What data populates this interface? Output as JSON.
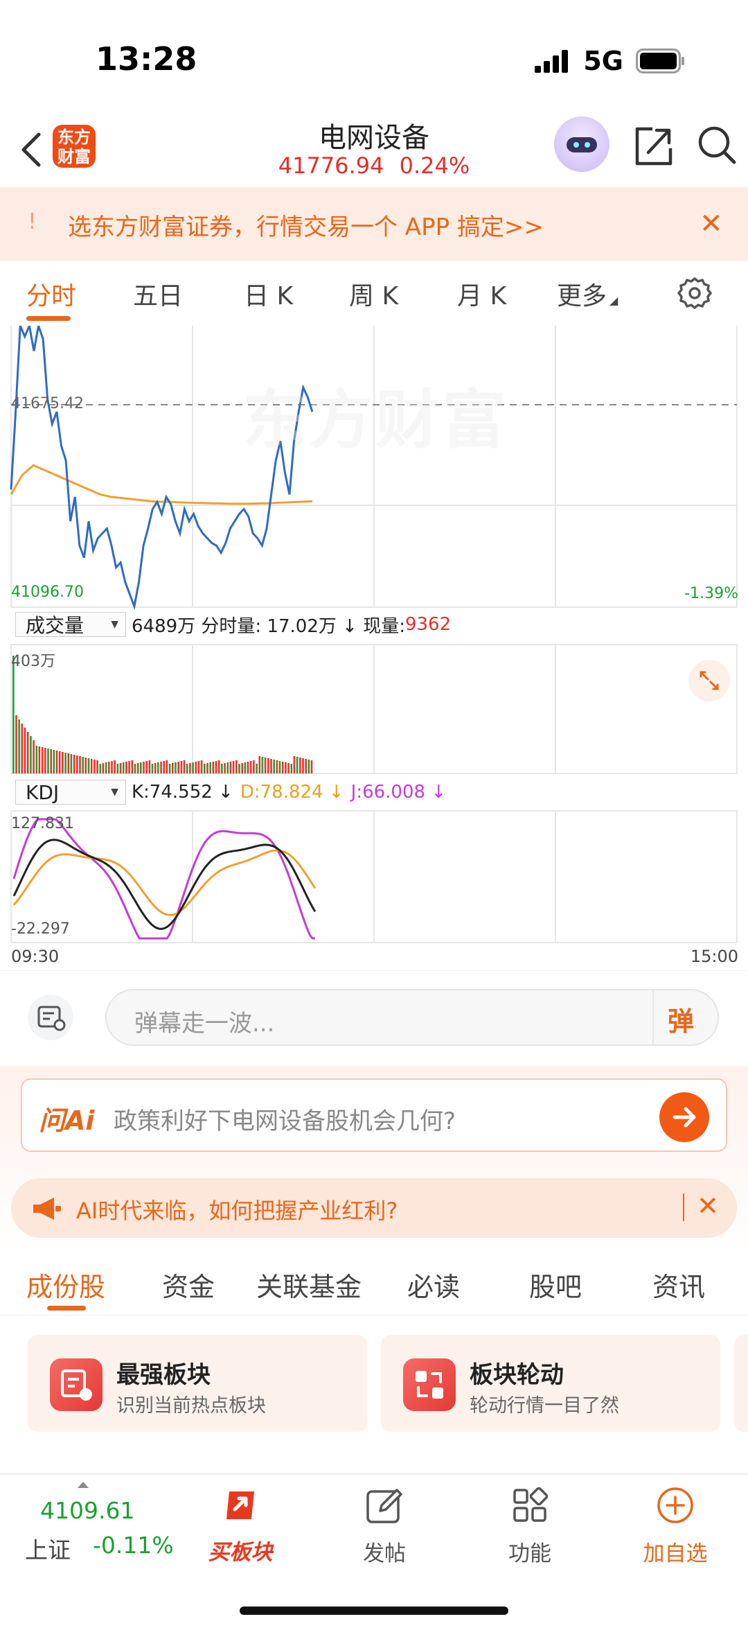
{
  "status_bar": {
    "time": "13:28",
    "network": "5G"
  },
  "header": {
    "logo_text": "东方财富",
    "title": "电网设备",
    "price": "41776.94",
    "change_pct": "0.24%"
  },
  "promo": {
    "mark": "!",
    "text": "选东方财富证券，行情交易一个 APP 搞定>>",
    "close": "✕"
  },
  "chart_tabs": [
    {
      "label": "分时",
      "active": true
    },
    {
      "label": "五日",
      "active": false
    },
    {
      "label": "日 K",
      "active": false
    },
    {
      "label": "周 K",
      "active": false
    },
    {
      "label": "月 K",
      "active": false
    },
    {
      "label": "更多",
      "active": false
    }
  ],
  "chart": {
    "watermark": "东方财富",
    "avg_price_label": "41675.42",
    "low_label": "41096.70",
    "low_pct_label": "-1.39%",
    "volume": {
      "selector": "成交量",
      "summary": "6489万 分时量: 17.02万 ↓ 现量: ",
      "current": "9362",
      "max_label": "403万"
    },
    "kdj": {
      "selector": "KDJ",
      "k": "K:74.552 ↓",
      "d": "D:78.824 ↓",
      "j": "J:66.008 ↓",
      "max_label": "127.831",
      "min_label": "-22.297"
    },
    "time_start": "09:30",
    "time_end": "15:00",
    "colors": {
      "price_line": "#2e6cc0",
      "avg_line": "#f0a030",
      "up": "#e8322a",
      "down": "#1aa032",
      "k": "#222222",
      "d": "#f0a030",
      "j": "#c33cd8"
    }
  },
  "chart_data": {
    "type": "line",
    "title": "",
    "xlabel": "",
    "ylabel": "",
    "x_range": [
      "09:30",
      "15:00"
    ],
    "ylim": [
      41096.7,
      42254.14
    ],
    "reference": 41675.42,
    "series": [
      {
        "values": [
          41580,
          41900,
          42254,
          42210,
          42254,
          42150,
          42254,
          42200,
          41950,
          41850,
          41900,
          41760,
          41700,
          41450,
          41550,
          41350,
          41300,
          41450,
          41330,
          41380,
          41400,
          41420,
          41350,
          41260,
          41280,
          41200,
          41150,
          41100,
          41200,
          41350,
          41420,
          41500,
          41530,
          41480,
          41550,
          41520,
          41450,
          41400,
          41500,
          41450,
          41480,
          41430,
          41400,
          41380,
          41360,
          41350,
          41320,
          41360,
          41420,
          41450,
          41480,
          41500,
          41470,
          41400,
          41380,
          41350,
          41420,
          41560,
          41700,
          41780,
          41650,
          41560,
          41780,
          41900,
          42000,
          41960,
          41900
        ],
        "color": "#2e6cc0"
      },
      {
        "values": [
          41560,
          41640,
          41680,
          41660,
          41640,
          41620,
          41600,
          41580,
          41560,
          41550,
          41545,
          41540,
          41535,
          41530,
          41530,
          41528,
          41526,
          41525,
          41524,
          41523,
          41522,
          41522,
          41523,
          41524,
          41526,
          41528,
          41530,
          41532
        ],
        "color": "#f0a030"
      }
    ]
  },
  "danmu": {
    "placeholder": "弹幕走一波...",
    "button": "弹"
  },
  "ai": {
    "logo": "问Ai",
    "question": "政策利好下电网设备股机会几何?"
  },
  "notice": {
    "text": "AI时代来临，如何把握产业红利?",
    "close": "✕"
  },
  "section_tabs": [
    {
      "label": "成份股",
      "active": true
    },
    {
      "label": "资金",
      "active": false
    },
    {
      "label": "关联基金",
      "active": false
    },
    {
      "label": "必读",
      "active": false
    },
    {
      "label": "股吧",
      "active": false
    },
    {
      "label": "资讯",
      "active": false
    }
  ],
  "cards": [
    {
      "title": "最强板块",
      "subtitle": "识别当前热点板块"
    },
    {
      "title": "板块轮动",
      "subtitle": "轮动行情一目了然"
    }
  ],
  "bottom_bar": {
    "index_value": "4109.61",
    "index_name": "上证",
    "index_change": "-0.11%",
    "buy_label": "买板块",
    "post_label": "发帖",
    "function_label": "功能",
    "add_label": "加自选"
  }
}
